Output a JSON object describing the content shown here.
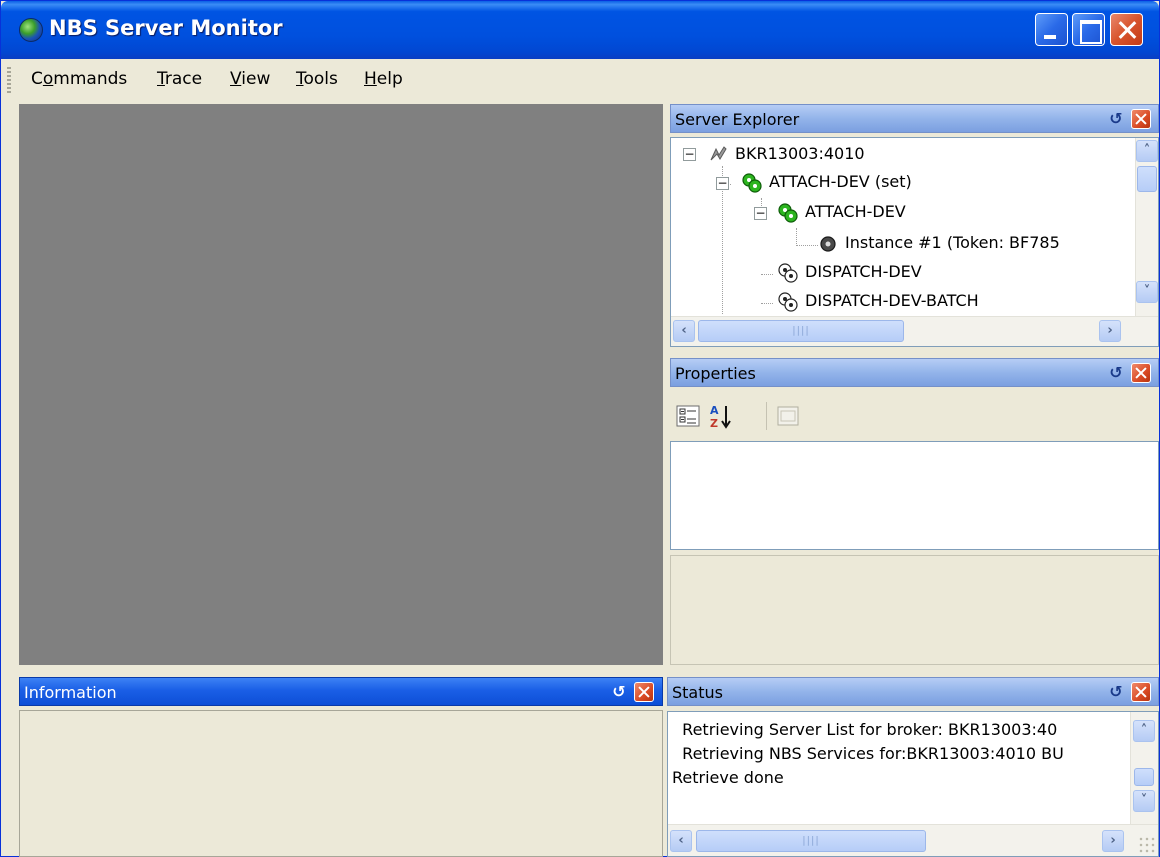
{
  "window": {
    "title": "NBS Server Monitor"
  },
  "menu": [
    {
      "label": "Commands"
    },
    {
      "label": "Trace"
    },
    {
      "label": "View"
    },
    {
      "label": "Tools"
    },
    {
      "label": "Help"
    }
  ],
  "server_explorer": {
    "title": "Server Explorer",
    "tree": [
      {
        "label": "BKR13003:4010",
        "level": 0,
        "expanded": true,
        "icon": "broker-icon"
      },
      {
        "label": "ATTACH-DEV (set)",
        "level": 1,
        "expanded": true,
        "icon": "service-set-icon"
      },
      {
        "label": "ATTACH-DEV",
        "level": 2,
        "expanded": true,
        "icon": "service-icon"
      },
      {
        "label": "Instance #1 (Token: BF785",
        "level": 3,
        "icon": "instance-icon"
      },
      {
        "label": "DISPATCH-DEV",
        "level": 2,
        "icon": "service-icon"
      },
      {
        "label": "DISPATCH-DEV-BATCH",
        "level": 2,
        "icon": "service-icon"
      }
    ]
  },
  "properties": {
    "title": "Properties"
  },
  "information": {
    "title": "Information"
  },
  "status": {
    "title": "Status",
    "lines": [
      "  Retrieving Server List for broker: BKR13003:40",
      "  Retrieving NBS Services for:BKR13003:4010 BU",
      "Retrieve done"
    ]
  },
  "colors": {
    "titlebar": "#0054e3",
    "active_panel": "#1a5fe6",
    "inactive_panel": "#93b4ea",
    "mdi_background": "#808080",
    "service_icon": "#2cb51f"
  }
}
